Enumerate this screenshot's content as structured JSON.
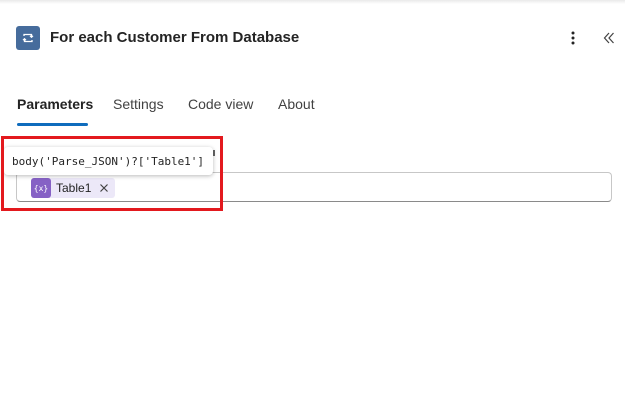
{
  "header": {
    "title": "For each Customer From Database",
    "action_icon": "loop-icon",
    "more_icon": "more-vertical-icon",
    "collapse_icon": "chevron-double-left-icon"
  },
  "tabs": [
    {
      "label": "Parameters",
      "active": true
    },
    {
      "label": "Settings",
      "active": false
    },
    {
      "label": "Code view",
      "active": false
    },
    {
      "label": "About",
      "active": false
    }
  ],
  "field": {
    "token": {
      "label": "Table1",
      "icon": "expression-icon",
      "icon_text": "{x}"
    }
  },
  "tooltip": {
    "text": "body('Parse_JSON')?['Table1']"
  },
  "colors": {
    "accent": "#0f6cbd",
    "action_icon_bg": "#466c9c",
    "token_bg": "#ece8f8",
    "token_icon_bg": "#8661c5",
    "highlight": "#e3191e"
  }
}
